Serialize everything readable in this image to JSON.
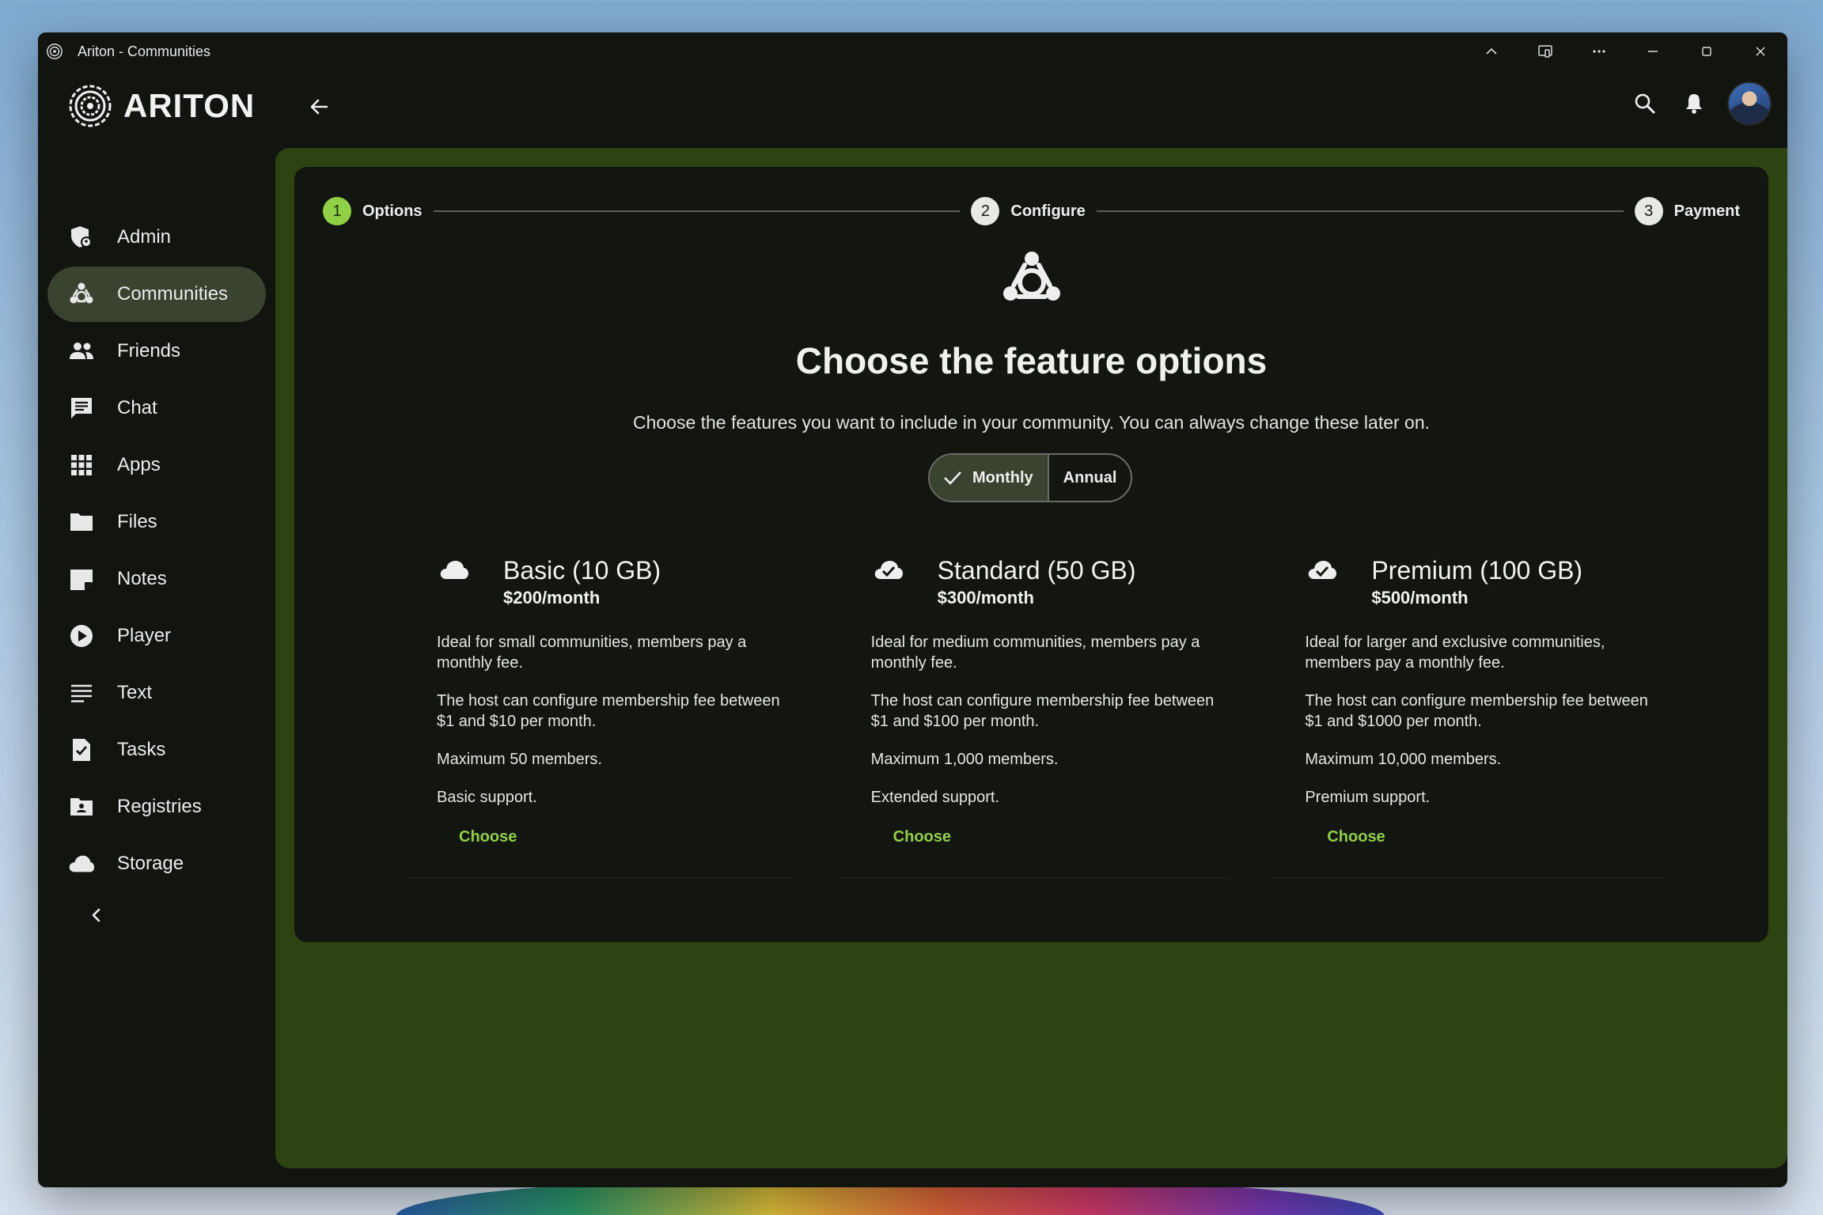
{
  "window": {
    "title": "Ariton - Communities"
  },
  "brand": {
    "name": "ARITON"
  },
  "sidebar": {
    "items": [
      {
        "label": "Admin",
        "icon": "admin-shield-icon",
        "active": false
      },
      {
        "label": "Communities",
        "icon": "communities-icon",
        "active": true
      },
      {
        "label": "Friends",
        "icon": "friends-icon",
        "active": false
      },
      {
        "label": "Chat",
        "icon": "chat-icon",
        "active": false
      },
      {
        "label": "Apps",
        "icon": "apps-grid-icon",
        "active": false
      },
      {
        "label": "Files",
        "icon": "folder-icon",
        "active": false
      },
      {
        "label": "Notes",
        "icon": "note-icon",
        "active": false
      },
      {
        "label": "Player",
        "icon": "play-icon",
        "active": false
      },
      {
        "label": "Text",
        "icon": "text-lines-icon",
        "active": false
      },
      {
        "label": "Tasks",
        "icon": "task-check-icon",
        "active": false
      },
      {
        "label": "Registries",
        "icon": "registry-folder-icon",
        "active": false
      },
      {
        "label": "Storage",
        "icon": "cloud-icon",
        "active": false
      }
    ]
  },
  "stepper": {
    "steps": [
      {
        "number": "1",
        "label": "Options",
        "active": true
      },
      {
        "number": "2",
        "label": "Configure",
        "active": false
      },
      {
        "number": "3",
        "label": "Payment",
        "active": false
      }
    ]
  },
  "main": {
    "heading": "Choose the feature options",
    "subheading": "Choose the features you want to include in your community. You can always change these later on.",
    "billing_toggle": {
      "monthly": "Monthly",
      "annual": "Annual",
      "selected": "Monthly"
    }
  },
  "plans": [
    {
      "name": "Basic (10 GB)",
      "price": "$200/month",
      "icon": "cloud-icon",
      "lines": [
        "Ideal for small communities, members pay a monthly fee.",
        "The host can configure membership fee between $1 and $10 per month.",
        "Maximum 50 members.",
        "Basic support."
      ],
      "cta": "Choose"
    },
    {
      "name": "Standard (50 GB)",
      "price": "$300/month",
      "icon": "cloud-check-icon",
      "lines": [
        "Ideal for medium communities, members pay a monthly fee.",
        "The host can configure membership fee between $1 and $100 per month.",
        "Maximum 1,000 members.",
        "Extended support."
      ],
      "cta": "Choose"
    },
    {
      "name": "Premium (100 GB)",
      "price": "$500/month",
      "icon": "cloud-check-icon",
      "lines": [
        "Ideal for larger and exclusive communities, members pay a monthly fee.",
        "The host can configure membership fee between $1 and $1000 per month.",
        "Maximum 10,000 members.",
        "Premium support."
      ],
      "cta": "Choose"
    }
  ],
  "colors": {
    "accent": "#8fd047",
    "content_bg": "#2e4312",
    "card_bg": "#131511",
    "active_nav": "#3a4230"
  }
}
